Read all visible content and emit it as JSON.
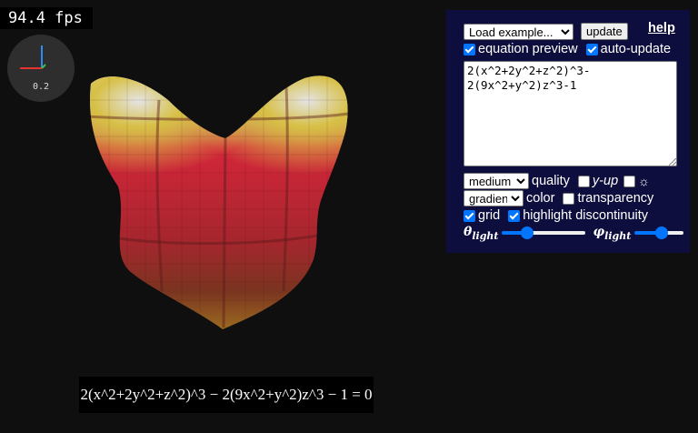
{
  "fps": "94.4 fps",
  "axes": {
    "scale": "0.2",
    "x_color": "#e5322f",
    "y_color": "#2a8df5",
    "z_color": "#3cc43c"
  },
  "equation_render": "2(x^2+2y^2+z^2)^3 − 2(9x^2+y^2)z^3 − 1 = 0",
  "panel": {
    "example_select": "Load example...",
    "update_label": "update",
    "help_label": "help",
    "equation_preview_label": "equation preview",
    "equation_preview_checked": true,
    "auto_update_label": "auto-update",
    "auto_update_checked": true,
    "equation_text": "2(x^2+2y^2+z^2)^3-2(9x^2+y^2)z^3-1",
    "quality_select": "medium",
    "quality_label": "quality",
    "y_up_label": "y-up",
    "y_up_checked": false,
    "sun_glyph": "☼",
    "sun_checked": false,
    "color_select": "gradient",
    "color_label": "color",
    "transparency_label": "transparency",
    "transparency_checked": false,
    "grid_label": "grid",
    "grid_checked": true,
    "highlight_label": "highlight discontinuity",
    "highlight_checked": true,
    "theta_symbol": "θ",
    "theta_sub": "light",
    "theta_value": 0.3,
    "phi_symbol": "φ",
    "phi_sub": "light",
    "phi_value": 0.55
  },
  "colors": {
    "panel_bg": "#0e0e3e",
    "accent": "#0075ff",
    "surface_red": "#c8283a",
    "surface_yellow": "#e8c43a"
  }
}
